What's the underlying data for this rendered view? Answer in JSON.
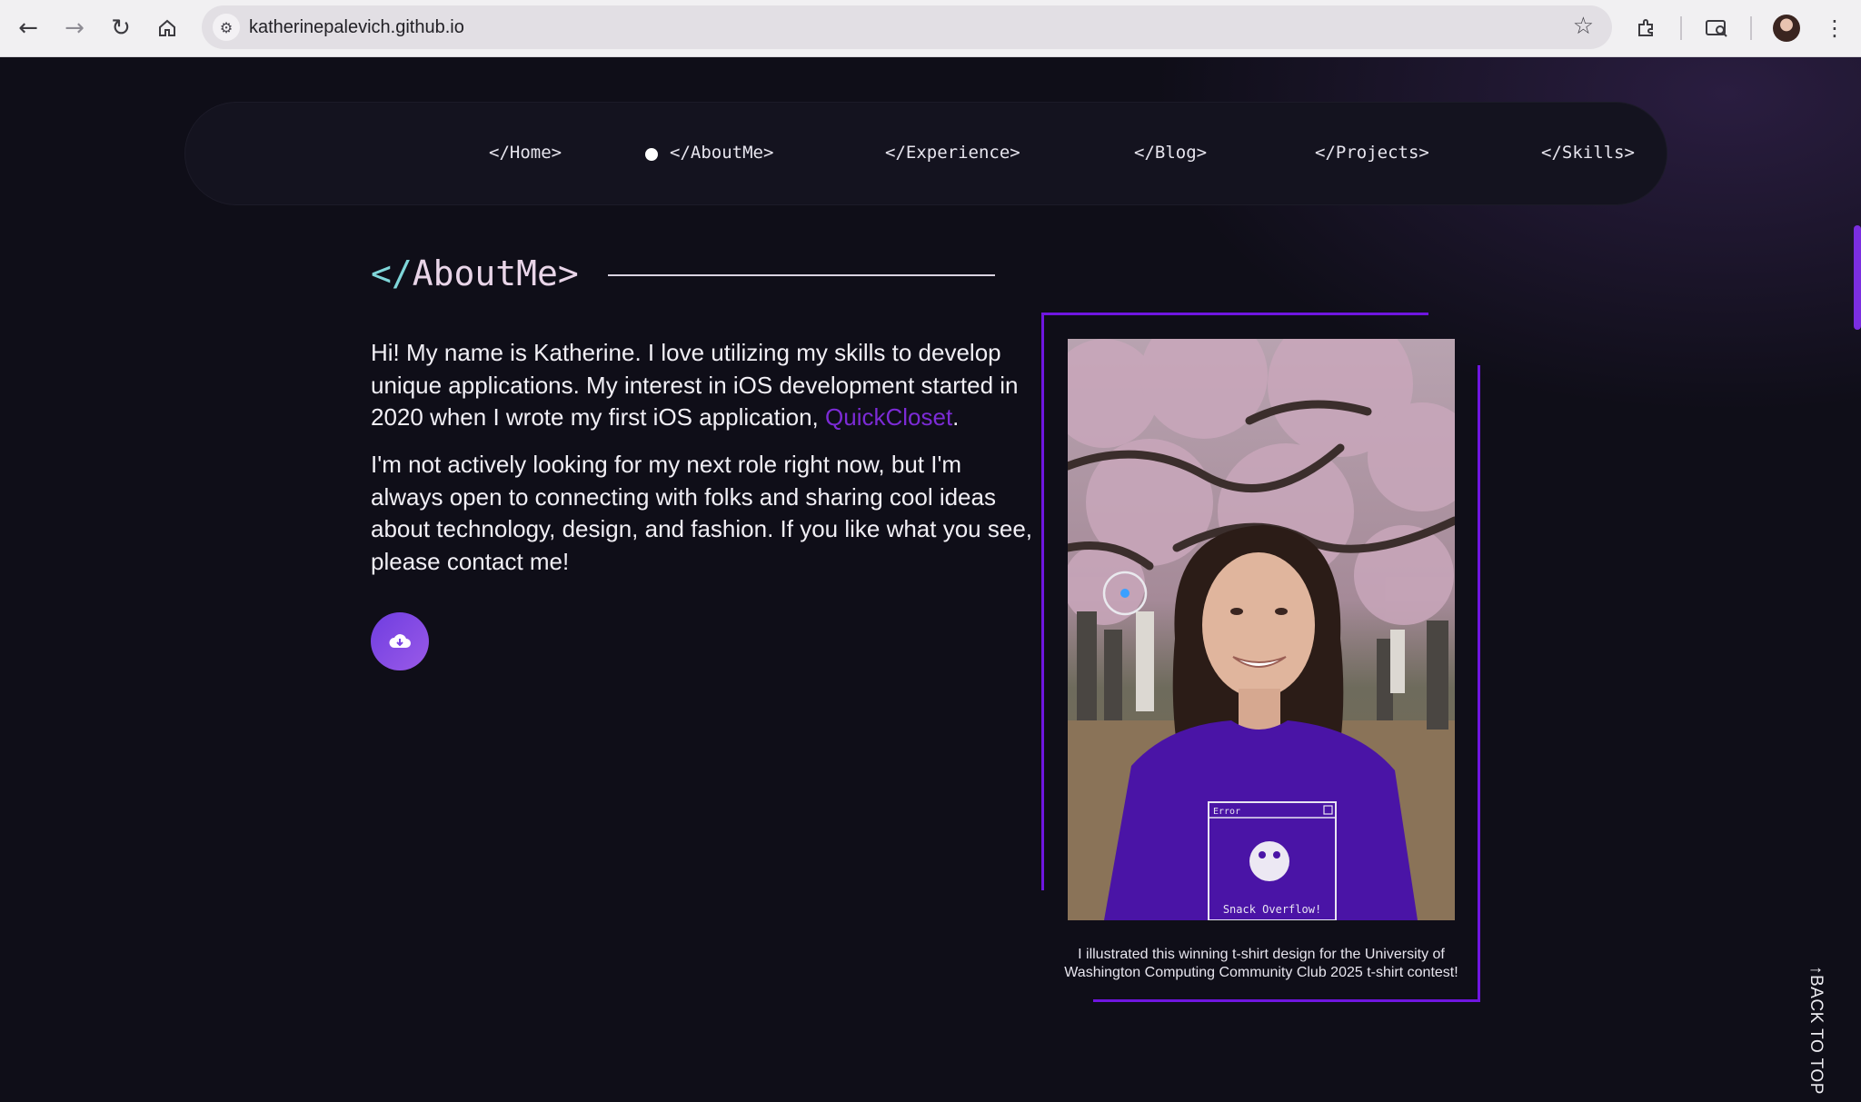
{
  "browser": {
    "url": "katherinepalevich.github.io",
    "icons": [
      "back-arrow-icon",
      "forward-arrow-icon",
      "reload-icon",
      "home-icon",
      "site-settings-icon",
      "bookmark-star-icon",
      "extensions-icon",
      "tab-search-icon",
      "profile-avatar",
      "kebab-menu-icon"
    ]
  },
  "nav": {
    "items": [
      "</Home>",
      "</AboutMe>",
      "</Experience>",
      "</Blog>",
      "</Projects>",
      "</Skills>"
    ],
    "active": "</AboutMe>"
  },
  "about": {
    "title_slash": "</",
    "title_text": "AboutMe>",
    "para1_before": "Hi! My name is Katherine. I love utilizing my skills to develop unique applications. My interest in iOS development started in 2020 when I wrote my first iOS application, ",
    "para1_link": "QuickCloset",
    "para1_after": ".",
    "para2": "I'm not actively looking for my next role right now, but I'm always open to connecting with folks and sharing cool ideas about technology, design, and fashion. If you like what you see, please contact me!",
    "download_icon": "cloud-download-icon"
  },
  "photo": {
    "caption": "I illustrated this winning t-shirt design for the University of Washington Computing Community Club 2025 t-shirt contest!",
    "shirt_error": "Error",
    "shirt_text": "Snack Overflow!"
  },
  "back_to_top": "↑BACK TO TOP",
  "colors": {
    "accent_purple": "#6f16e0",
    "link_purple": "#7c2bd6",
    "background": "#0f0e18"
  }
}
